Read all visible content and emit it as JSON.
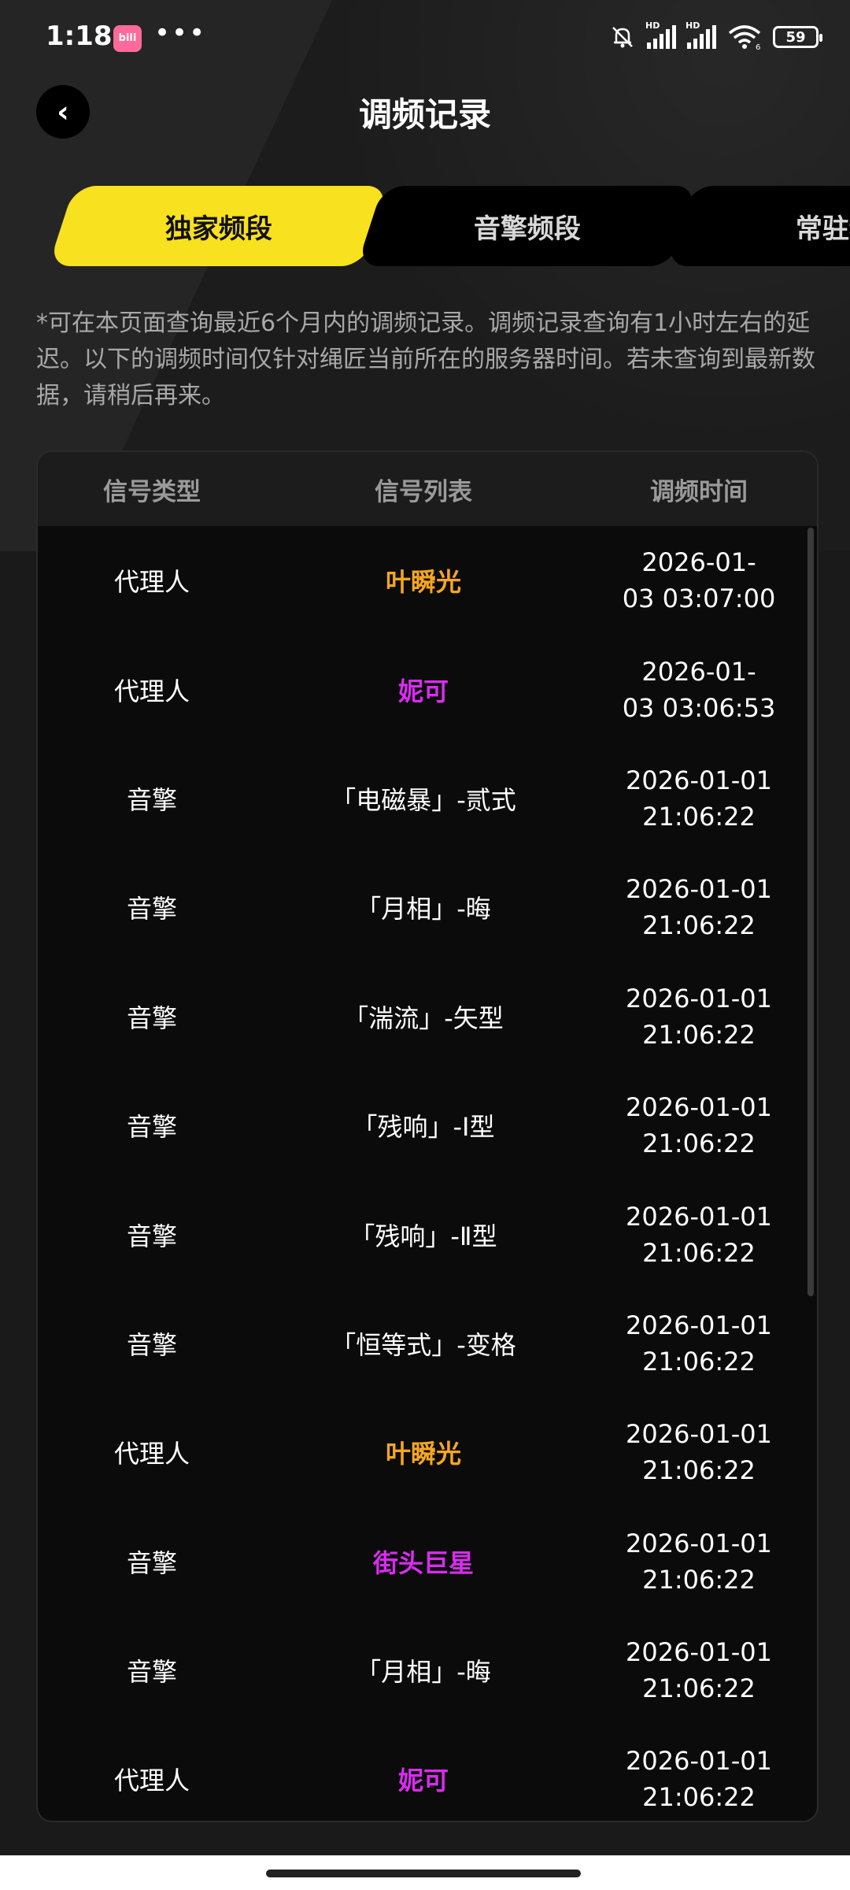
{
  "status_bar": {
    "time": "1:18",
    "app_badge": "bilibili",
    "more": "•••",
    "signal1_label": "HD",
    "signal2_label": "HD",
    "wifi_label": "6",
    "battery": "59"
  },
  "header": {
    "back_icon": "‹",
    "title": "调频记录"
  },
  "tabs": [
    {
      "label": "独家频段",
      "active": true
    },
    {
      "label": "音擎频段",
      "active": false
    },
    {
      "label": "常驻频",
      "active": false
    }
  ],
  "notice": "*可在本页面查询最近6个月内的调频记录。调频记录查询有1小时左右的延迟。以下的调频时间仅针对绳匠当前所在的服务器时间。若未查询到最新数据，请稍后再来。",
  "table": {
    "headers": [
      "信号类型",
      "信号列表",
      "调频时间"
    ],
    "rows": [
      {
        "type": "代理人",
        "name": "叶瞬光",
        "time": "2026-01-\n03 03:07:00",
        "color": "#f5a623"
      },
      {
        "type": "代理人",
        "name": "妮可",
        "time": "2026-01-\n03 03:06:53",
        "color": "#d92cf0"
      },
      {
        "type": "音擎",
        "name": "「电磁暴」-贰式",
        "time": "2026-01-01\n21:06:22",
        "color": ""
      },
      {
        "type": "音擎",
        "name": "「月相」-晦",
        "time": "2026-01-01\n21:06:22",
        "color": ""
      },
      {
        "type": "音擎",
        "name": "「湍流」-矢型",
        "time": "2026-01-01\n21:06:22",
        "color": ""
      },
      {
        "type": "音擎",
        "name": "「残响」-Ⅰ型",
        "time": "2026-01-01\n21:06:22",
        "color": ""
      },
      {
        "type": "音擎",
        "name": "「残响」-Ⅱ型",
        "time": "2026-01-01\n21:06:22",
        "color": ""
      },
      {
        "type": "音擎",
        "name": "「恒等式」-变格",
        "time": "2026-01-01\n21:06:22",
        "color": ""
      },
      {
        "type": "代理人",
        "name": "叶瞬光",
        "time": "2026-01-01\n21:06:22",
        "color": "#f5a623"
      },
      {
        "type": "音擎",
        "name": "街头巨星",
        "time": "2026-01-01\n21:06:22",
        "color": "#d92cf0"
      },
      {
        "type": "音擎",
        "name": "「月相」-晦",
        "time": "2026-01-01\n21:06:22",
        "color": ""
      },
      {
        "type": "代理人",
        "name": "妮可",
        "time": "2026-01-01\n21:06:22",
        "color": "#d92cf0"
      }
    ]
  },
  "colors": {
    "accent": "#f8e11e",
    "s_rank_gold": "#f5a623",
    "a_rank_purple": "#d92cf0"
  }
}
